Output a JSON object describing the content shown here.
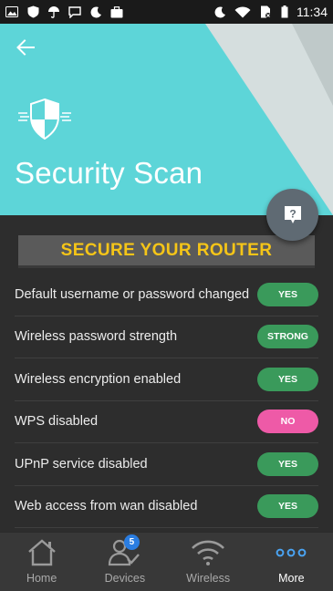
{
  "status_bar": {
    "time": "11:34",
    "left_icons": [
      "image-icon",
      "shield-check-icon",
      "umbrella-icon",
      "chat-icon",
      "moon-icon",
      "briefcase-icon"
    ],
    "right_icons": [
      "moon-icon",
      "wifi-icon",
      "no-sim-icon",
      "battery-icon"
    ]
  },
  "header": {
    "title": "Security Scan",
    "accent_color": "#5dd5d8"
  },
  "banner": {
    "label": "SECURE YOUR ROUTER",
    "color": "#f5c518"
  },
  "checks": [
    {
      "label": "Default username or password changed",
      "status": "YES",
      "color": "#3a9a5b"
    },
    {
      "label": "Wireless password strength",
      "status": "STRONG",
      "color": "#3a9a5b"
    },
    {
      "label": "Wireless encryption enabled",
      "status": "YES",
      "color": "#3a9a5b"
    },
    {
      "label": "WPS disabled",
      "status": "NO",
      "color": "#ee5aa7"
    },
    {
      "label": "UPnP service disabled",
      "status": "YES",
      "color": "#3a9a5b"
    },
    {
      "label": "Web access from wan disabled",
      "status": "YES",
      "color": "#3a9a5b"
    }
  ],
  "bottom_nav": [
    {
      "label": "Home",
      "icon": "home-icon"
    },
    {
      "label": "Devices",
      "icon": "devices-icon",
      "badge": "5"
    },
    {
      "label": "Wireless",
      "icon": "wifi-icon"
    },
    {
      "label": "More",
      "icon": "more-icon",
      "active": true
    }
  ]
}
